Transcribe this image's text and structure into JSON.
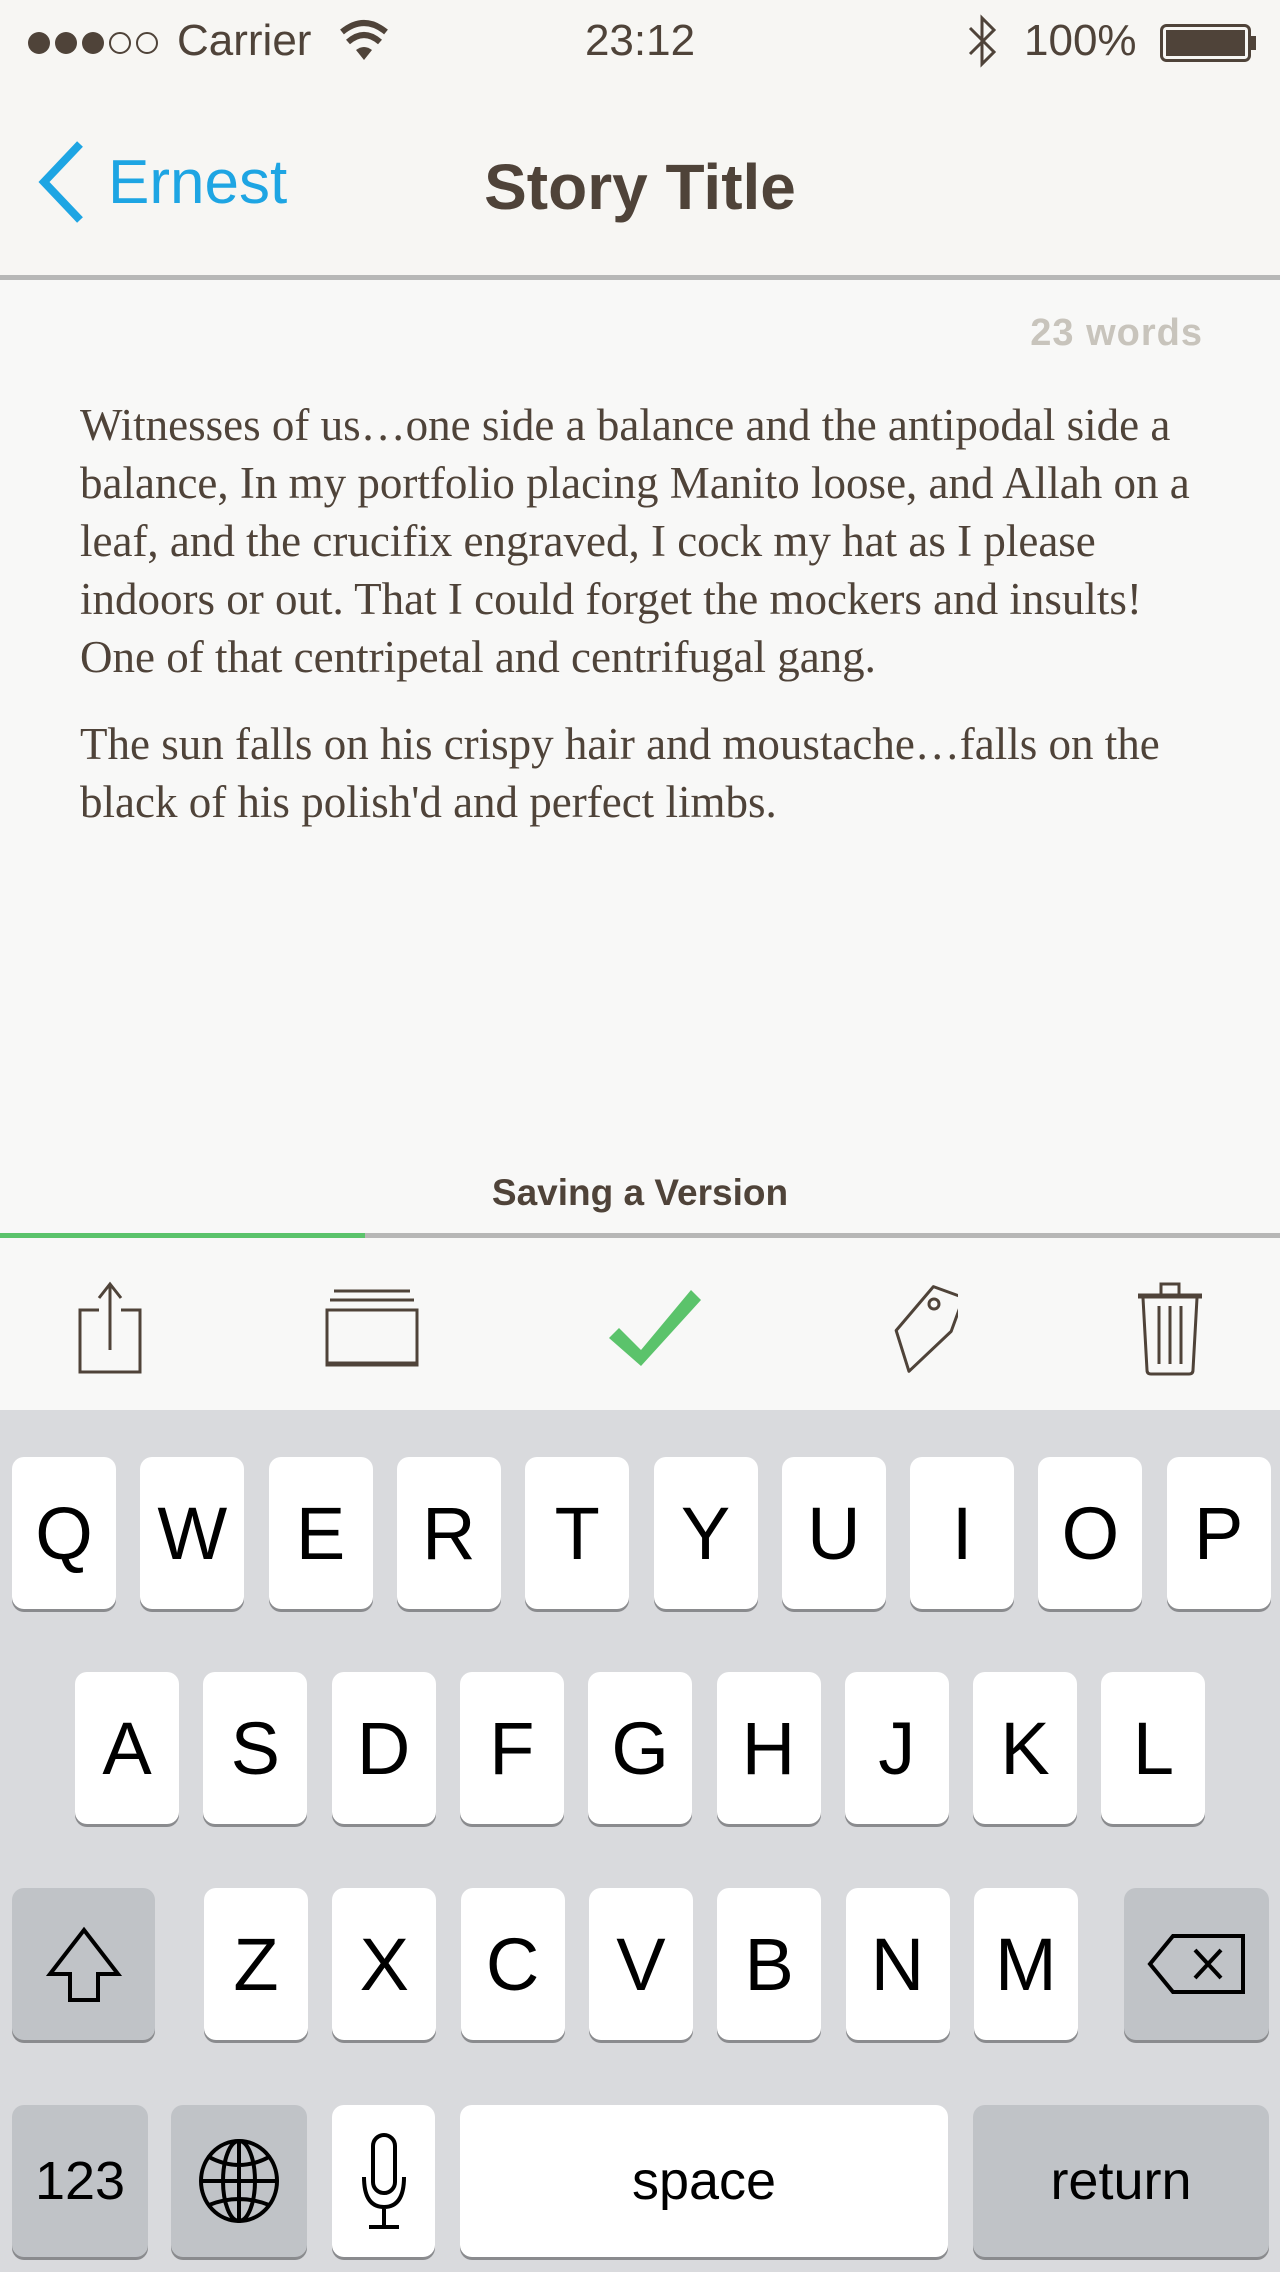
{
  "status_bar": {
    "signal_filled": 3,
    "signal_total": 5,
    "carrier": "Carrier",
    "time": "23:12",
    "battery": "100%",
    "icons": [
      "signal-dots",
      "wifi-icon",
      "bluetooth-icon",
      "battery-icon"
    ]
  },
  "nav": {
    "back_label": "Ernest",
    "title": "Story Title",
    "accent": "#1ea5e3"
  },
  "editor": {
    "word_count": "23 words",
    "paragraphs": [
      "Witnesses of us…one side a balance and the antipodal side a balance, In my portfolio placing Manito loose, and Allah on a leaf, and the crucifix engraved, I cock my hat as I please indoors or out. That I could forget the mockers and insults! One of that centripetal and centrifugal gang.",
      "The sun falls on his crispy hair and moustache…falls on the black of his polish'd and perfect limbs."
    ]
  },
  "saving": {
    "label": "Saving a Version",
    "progress_percent": 28.5,
    "progress_color": "#5bc36b"
  },
  "toolbar": {
    "icons": [
      "share-icon",
      "versions-icon",
      "checkmark-icon",
      "tag-icon",
      "trash-icon"
    ]
  },
  "keyboard": {
    "rows": [
      [
        "Q",
        "W",
        "E",
        "R",
        "T",
        "Y",
        "U",
        "I",
        "O",
        "P"
      ],
      [
        "A",
        "S",
        "D",
        "F",
        "G",
        "H",
        "J",
        "K",
        "L"
      ],
      [
        "Z",
        "X",
        "C",
        "V",
        "B",
        "N",
        "M"
      ]
    ],
    "numbers_label": "123",
    "space_label": "space",
    "return_label": "return"
  }
}
